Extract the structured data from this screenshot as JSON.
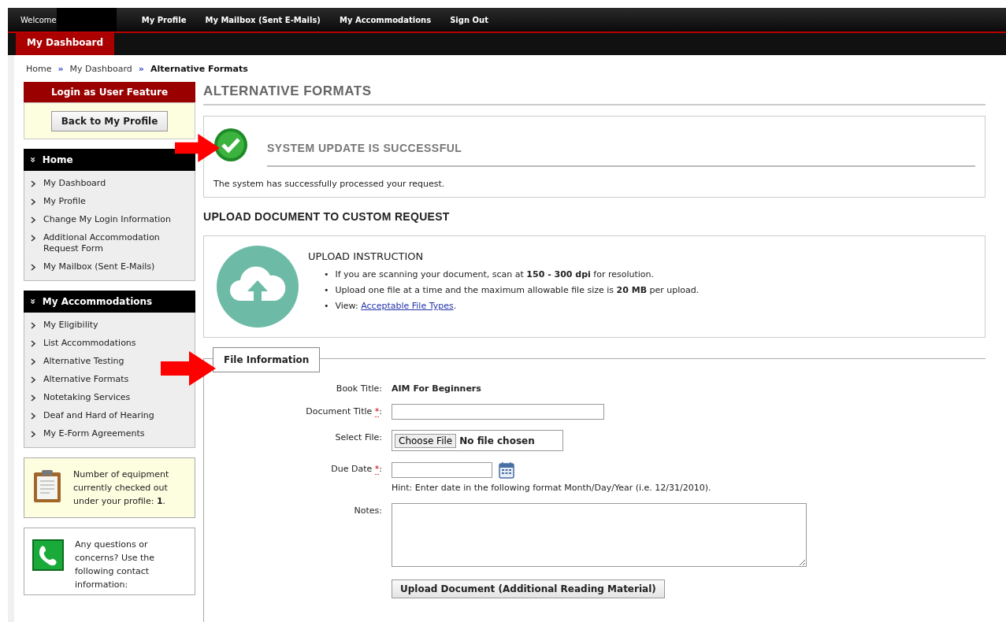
{
  "top_nav": {
    "welcome": "Welcome",
    "links": [
      "My Profile",
      "My Mailbox (Sent E-Mails)",
      "My Accommodations",
      "Sign Out"
    ]
  },
  "tabs": [
    {
      "label": "My Dashboard",
      "selected": true
    }
  ],
  "breadcrumb": [
    {
      "label": "Home",
      "current": false
    },
    {
      "label": "My Dashboard",
      "current": false
    },
    {
      "label": "Alternative Formats",
      "current": true
    }
  ],
  "breadcrumb_separator": "»",
  "sidebar": {
    "login_feature": {
      "title": "Login as User Feature",
      "button": "Back to My Profile"
    },
    "menus": [
      {
        "title": "Home",
        "icon": "»",
        "items": [
          "My Dashboard",
          "My Profile",
          "Change My Login Information",
          "Additional Accommodation Request Form",
          "My Mailbox (Sent E-Mails)"
        ]
      },
      {
        "title": "My Accommodations",
        "icon": "»",
        "items": [
          "My Eligibility",
          "List Accommodations",
          "Alternative Testing",
          "Alternative Formats",
          "Notetaking Services",
          "Deaf and Hard of Hearing",
          "My E-Form Agreements"
        ]
      }
    ],
    "equipment_note": "Number of equipment currently checked out under your profile: **1**.",
    "contact_note": "Any questions or concerns? Use the following contact information:"
  },
  "main": {
    "title": "ALTERNATIVE FORMATS",
    "alert": {
      "title": "SYSTEM UPDATE IS SUCCESSFUL",
      "message": "The system has successfully processed your request."
    },
    "section_title": "UPLOAD DOCUMENT TO CUSTOM REQUEST",
    "instructions": {
      "title": "UPLOAD INSTRUCTION",
      "bullets": [
        {
          "marker": "•",
          "text": "If you are scanning your document, scan at **150 - 300 dpi** for resolution."
        },
        {
          "marker": "•",
          "text": "Upload one file at a time and the maximum allowable file size is **20 MB** per upload."
        },
        {
          "marker": "•",
          "text": "View: ",
          "link": "Acceptable File Types",
          "after": "."
        }
      ]
    },
    "fieldset": {
      "legend": "File Information",
      "fields": [
        {
          "kind": "static",
          "label": "Book Title:",
          "value": "AIM For Beginners"
        },
        {
          "kind": "text",
          "label": "Document Title ",
          "required_mark": "*",
          "label_end": ":"
        },
        {
          "kind": "file",
          "label": "Select File:",
          "button": "Choose File",
          "status": "No file chosen"
        },
        {
          "kind": "date",
          "label": "Due Date ",
          "required_mark": "*",
          "label_end": ":",
          "hint": "Hint: Enter date in the following format Month/Day/Year (i.e. 12/31/2010)."
        },
        {
          "kind": "textarea",
          "label": "Notes:"
        }
      ],
      "submit": "Upload Document (Additional Reading Material)"
    }
  }
}
